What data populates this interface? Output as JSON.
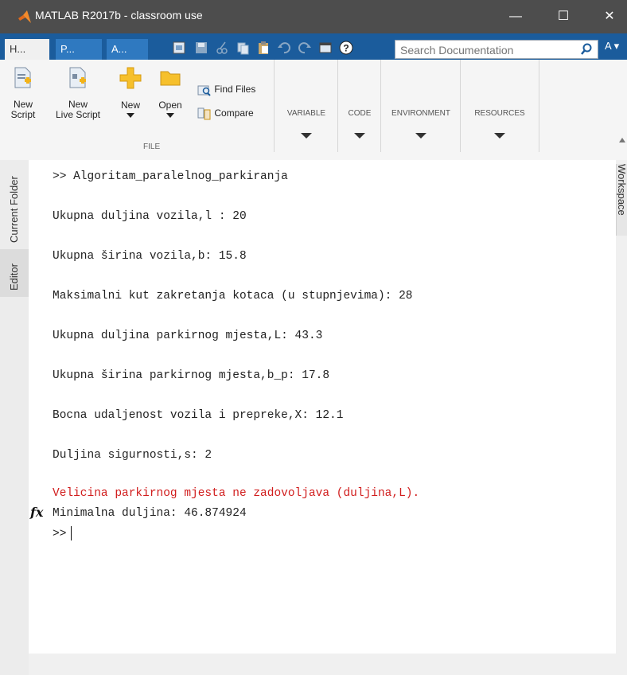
{
  "window": {
    "title": "MATLAB R2017b - classroom use",
    "minimize": "—",
    "maximize": "☐",
    "close": "✕"
  },
  "tabs": [
    {
      "label": "H..."
    },
    {
      "label": "P..."
    },
    {
      "label": "A..."
    }
  ],
  "search": {
    "placeholder": "Search Documentation"
  },
  "account": {
    "label": "A ▾"
  },
  "ribbon": {
    "new_script": [
      "New",
      "Script"
    ],
    "new_live_script": [
      "New",
      "Live Script"
    ],
    "new": "New",
    "open": "Open",
    "find_files": "Find Files",
    "compare": "Compare",
    "file_section": "FILE",
    "sections": [
      "VARIABLE",
      "CODE",
      "ENVIRONMENT",
      "RESOURCES"
    ]
  },
  "sidebar": {
    "current_folder": "Current Folder",
    "editor": "Editor"
  },
  "workspace": {
    "label": "Workspace"
  },
  "console": {
    "lines": [
      ">> Algoritam_paralelnog_parkiranja",
      "Ukupna duljina vozila,l : 20",
      "Ukupna širina vozila,b: 15.8",
      "Maksimalni kut zakretanja kotaca (u stupnjevima): 28",
      "Ukupna duljina parkirnog mjesta,L: 43.3",
      "Ukupna širina parkirnog mjesta,b_p: 17.8",
      "Bocna udaljenost vozila i prepreke,X: 12.1",
      "Duljina sigurnosti,s: 2"
    ],
    "error": "Velicina parkirnog mjesta ne zadovoljava (duljina,L).",
    "result": "Minimalna duljina: 46.874924",
    "fx": "fx",
    "prompt": ">>"
  },
  "colors": {
    "titlebar": "#4d4d4d",
    "tabbar": "#1b5c9c",
    "error": "#d11d1d"
  }
}
